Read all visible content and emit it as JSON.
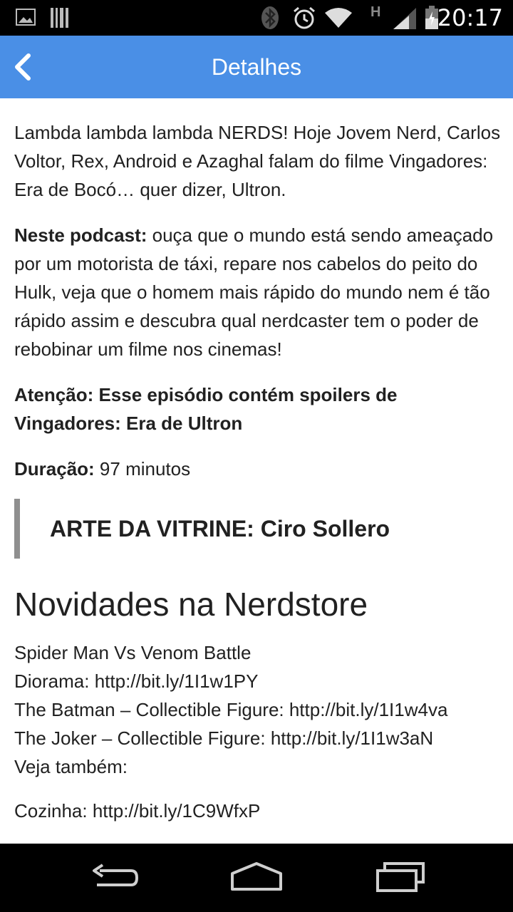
{
  "status_bar": {
    "time": "20:17",
    "icons": [
      "image-icon",
      "barcode-icon",
      "bluetooth-icon",
      "alarm-icon",
      "wifi-icon",
      "signal-icon",
      "battery-icon"
    ],
    "network_letter": "H"
  },
  "app_bar": {
    "title": "Detalhes",
    "back_icon": "chevron-left-icon",
    "color": "#4a8fe6"
  },
  "article": {
    "intro": "Lambda lambda lambda NERDS! Hoje Jovem Nerd, Carlos Voltor, Rex, Android e Azaghal falam do filme Vingadores: Era de Bocó… quer dizer, Ultron.",
    "podcast_label": "Neste podcast:",
    "podcast_text": " ouça que o mundo está sendo ameaçado por um motorista de táxi, repare nos cabelos do peito do Hulk, veja que o homem mais rápido do mundo nem é tão rápido assim e descubra qual nerdcaster tem o poder de rebobinar um filme nos cinemas!",
    "warning": "Atenção: Esse episódio contém spoilers de Vingadores: Era de Ultron",
    "duration_label": "Duração:",
    "duration_value": " 97 minutos",
    "art_credit": "ARTE DA VITRINE: Ciro Sollero",
    "store_heading": "Novidades na Nerdstore",
    "store_lines": [
      "Spider Man Vs Venom Battle",
      "Diorama: http://bit.ly/1I1w1PY",
      "The Batman – Collectible Figure: http://bit.ly/1I1w4va",
      "The Joker – Collectible Figure: http://bit.ly/1I1w3aN",
      "Veja também:"
    ],
    "extra_link": "Cozinha: http://bit.ly/1C9WfxP"
  },
  "nav_bar": {
    "icons": [
      "back-nav-icon",
      "home-icon",
      "recents-icon"
    ]
  }
}
